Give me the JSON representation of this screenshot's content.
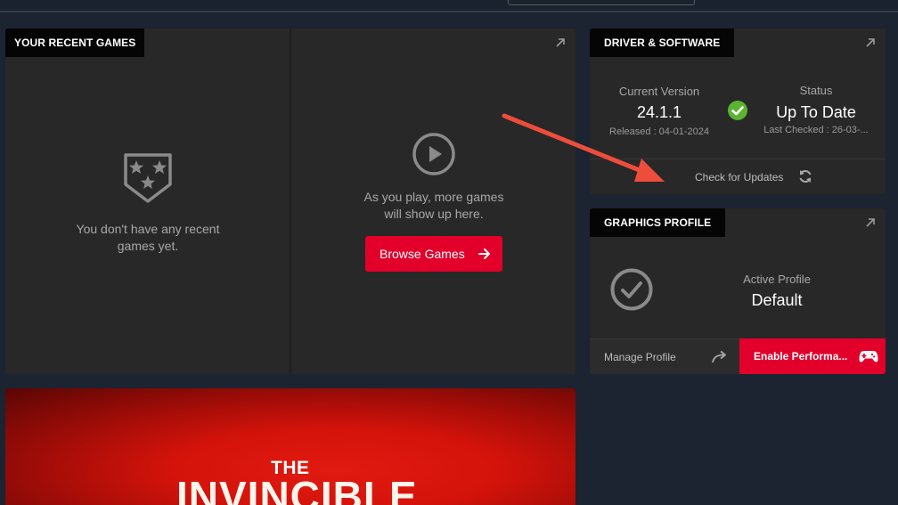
{
  "recent_games": {
    "title": "YOUR RECENT GAMES",
    "empty_line1": "You don't have any recent",
    "empty_line2": "games yet.",
    "play_line1": "As you play, more games",
    "play_line2": "will show up here.",
    "browse_label": "Browse Games"
  },
  "banner": {
    "the": "THE",
    "title": "INVINCIBLE"
  },
  "driver": {
    "title": "DRIVER & SOFTWARE",
    "current_label": "Current Version",
    "current_value": "24.1.1",
    "released": "Released : 04-01-2024",
    "status_label": "Status",
    "status_value": "Up To Date",
    "last_checked": "Last Checked : 26-03-...",
    "check_updates": "Check for Updates"
  },
  "profile": {
    "title": "GRAPHICS PROFILE",
    "active_label": "Active Profile",
    "active_value": "Default",
    "manage_label": "Manage Profile",
    "enable_label": "Enable Performa..."
  },
  "colors": {
    "accent": "#e2002b",
    "status_green": "#5bb332",
    "annotation": "#ee4d3b"
  }
}
